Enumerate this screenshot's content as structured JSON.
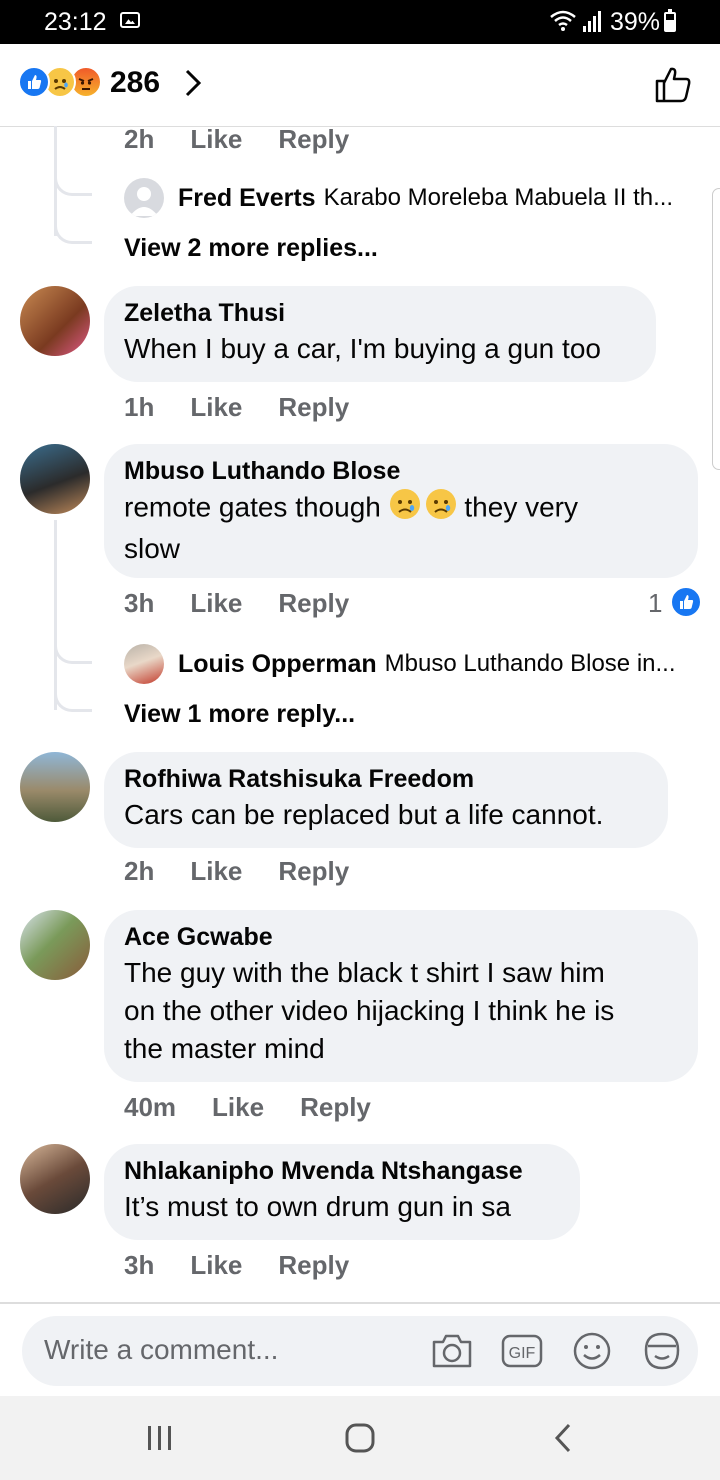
{
  "status_bar": {
    "time": "23:12",
    "battery": "39%"
  },
  "reactions": {
    "count": "286",
    "icons": [
      "like-icon",
      "sad-icon",
      "angry-icon"
    ]
  },
  "thread_top": {
    "meta": {
      "time": "2h",
      "like": "Like",
      "reply": "Reply"
    },
    "reply_preview": {
      "name": "Fred Everts",
      "text": "Karabo Moreleba Mabuela II  th..."
    },
    "view_more": "View 2 more replies..."
  },
  "comments": [
    {
      "name": "Zeletha Thusi",
      "text": "When I buy a car, I'm buying a gun too",
      "time": "1h",
      "like": "Like",
      "reply": "Reply"
    },
    {
      "name": "Mbuso Luthando Blose",
      "text_line1": "remote gates though",
      "text_line1_end": "they very",
      "text_line2": "slow",
      "time": "3h",
      "like": "Like",
      "reply": "Reply",
      "like_count": "1",
      "reply_preview": {
        "name": "Louis Opperman",
        "text": "Mbuso Luthando Blose in..."
      },
      "view_more": "View 1 more reply..."
    },
    {
      "name": "Rofhiwa Ratshisuka Freedom",
      "text": "Cars can be replaced but a life cannot.",
      "time": "2h",
      "like": "Like",
      "reply": "Reply"
    },
    {
      "name": "Ace Gcwabe",
      "lines": [
        "The guy with the black t shirt I saw him",
        "on the other video hijacking I think he is",
        "the master mind"
      ],
      "time": "40m",
      "like": "Like",
      "reply": "Reply"
    },
    {
      "name": "Nhlakanipho Mvenda Ntshangase",
      "text": "It’s must to own drum gun in sa",
      "time": "3h",
      "like": "Like",
      "reply": "Reply"
    }
  ],
  "composer": {
    "placeholder": "Write a comment..."
  },
  "colors": {
    "accent": "#1877f2",
    "bubble": "#f0f2f5",
    "meta": "#65676b"
  }
}
